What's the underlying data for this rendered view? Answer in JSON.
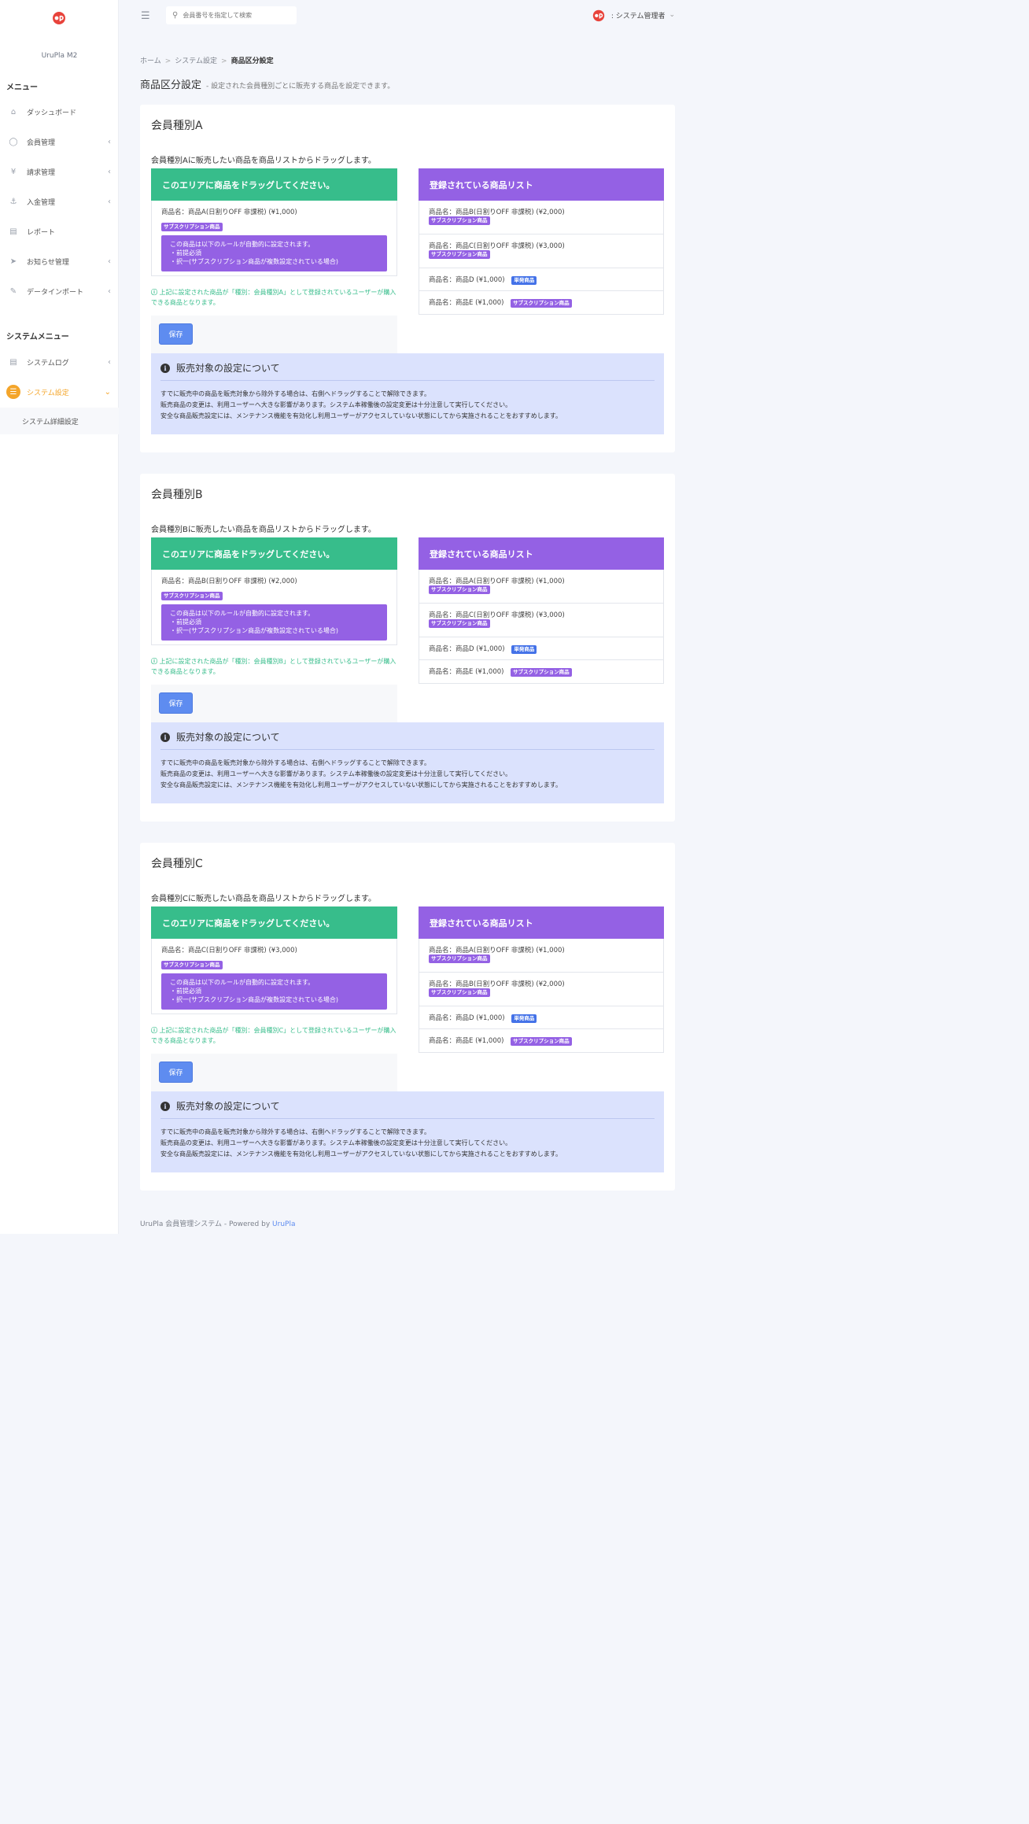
{
  "app": {
    "brand": "UruPla M2"
  },
  "sidebar": {
    "menu_heading": "メニュー",
    "items": [
      {
        "label": "ダッシュボード",
        "icon": "home-icon",
        "has_chevron": false
      },
      {
        "label": "会員管理",
        "icon": "user-icon",
        "has_chevron": true
      },
      {
        "label": "請求管理",
        "icon": "yen-icon",
        "has_chevron": true
      },
      {
        "label": "入金管理",
        "icon": "bank-icon",
        "has_chevron": true
      },
      {
        "label": "レポート",
        "icon": "document-icon",
        "has_chevron": false
      },
      {
        "label": "お知らせ管理",
        "icon": "paper-plane-icon",
        "has_chevron": true
      },
      {
        "label": "データインポート",
        "icon": "edit-icon",
        "has_chevron": true
      }
    ],
    "system_heading": "システムメニュー",
    "system_items": [
      {
        "label": "システムログ",
        "icon": "document-icon",
        "has_chevron": true
      },
      {
        "label": "システム設定",
        "icon": "layers-icon",
        "has_chevron": true,
        "active": true
      }
    ],
    "submenu": "システム詳細設定"
  },
  "topbar": {
    "search_placeholder": "会員番号を指定して検索",
    "user_label": ": システム管理者"
  },
  "breadcrumb": {
    "home": "ホーム",
    "parent": "システム設定",
    "current": "商品区分設定",
    "sep": ">"
  },
  "page": {
    "title": "商品区分設定",
    "subtitle": "- 設定された会員種別ごとに販売する商品を設定できます。"
  },
  "common": {
    "drop_heading": "このエリアに商品をドラッグしてください。",
    "list_heading": "登録されている商品リスト",
    "rule_lines": [
      "この商品は以下のルールが自動的に設定されます。",
      "・前提必須",
      "・択一(サブスクリプション商品が複数設定されている場合)"
    ],
    "save": "保存",
    "info_title": "販売対象の設定について",
    "info_lines": [
      "すでに販売中の商品を販売対象から除外する場合は、右側へドラッグすることで解除できます。",
      "販売商品の変更は、利用ユーザーへ大きな影響があります。システム本稼働後の設定変更は十分注意して実行してください。",
      "安全な商品販売設定には、メンテナンス機能を有効化し利用ユーザーがアクセスしていない状態にしてから実施されることをおすすめします。"
    ]
  },
  "sections": [
    {
      "title": "会員種別A",
      "desc": "会員種別Aに販売したい商品を商品リストからドラッグします。",
      "assigned": {
        "name": "商品名：商品A(日割りOFF 非課税) (¥1,000)",
        "badge": "サブスクリプション商品"
      },
      "note": "上記に設定された商品が「種別：会員種別A」として登録されているユーザーが購入できる商品となります。",
      "list": [
        {
          "name": "商品名：商品B(日割りOFF 非課税) (¥2,000)",
          "badge": "サブスクリプション商品",
          "badge_type": "sub",
          "inline": false
        },
        {
          "name": "商品名：商品C(日割りOFF 非課税) (¥3,000)",
          "badge": "サブスクリプション商品",
          "badge_type": "sub",
          "inline": false
        },
        {
          "name": "商品名：商品D (¥1,000)",
          "badge": "単発商品",
          "badge_type": "single",
          "inline": true
        },
        {
          "name": "商品名：商品E (¥1,000)",
          "badge": "サブスクリプション商品",
          "badge_type": "sub",
          "inline": true
        }
      ]
    },
    {
      "title": "会員種別B",
      "desc": "会員種別Bに販売したい商品を商品リストからドラッグします。",
      "assigned": {
        "name": "商品名：商品B(日割りOFF 非課税) (¥2,000)",
        "badge": "サブスクリプション商品"
      },
      "note": "上記に設定された商品が「種別：会員種別B」として登録されているユーザーが購入できる商品となります。",
      "list": [
        {
          "name": "商品名：商品A(日割りOFF 非課税) (¥1,000)",
          "badge": "サブスクリプション商品",
          "badge_type": "sub",
          "inline": false
        },
        {
          "name": "商品名：商品C(日割りOFF 非課税) (¥3,000)",
          "badge": "サブスクリプション商品",
          "badge_type": "sub",
          "inline": false
        },
        {
          "name": "商品名：商品D (¥1,000)",
          "badge": "単発商品",
          "badge_type": "single",
          "inline": true
        },
        {
          "name": "商品名：商品E (¥1,000)",
          "badge": "サブスクリプション商品",
          "badge_type": "sub",
          "inline": true
        }
      ]
    },
    {
      "title": "会員種別C",
      "desc": "会員種別Cに販売したい商品を商品リストからドラッグします。",
      "assigned": {
        "name": "商品名：商品C(日割りOFF 非課税) (¥3,000)",
        "badge": "サブスクリプション商品"
      },
      "note": "上記に設定された商品が「種別：会員種別C」として登録されているユーザーが購入できる商品となります。",
      "list": [
        {
          "name": "商品名：商品A(日割りOFF 非課税) (¥1,000)",
          "badge": "サブスクリプション商品",
          "badge_type": "sub",
          "inline": false
        },
        {
          "name": "商品名：商品B(日割りOFF 非課税) (¥2,000)",
          "badge": "サブスクリプション商品",
          "badge_type": "sub",
          "inline": false
        },
        {
          "name": "商品名：商品D (¥1,000)",
          "badge": "単発商品",
          "badge_type": "single",
          "inline": true
        },
        {
          "name": "商品名：商品E (¥1,000)",
          "badge": "サブスクリプション商品",
          "badge_type": "sub",
          "inline": true
        }
      ]
    }
  ],
  "footer": {
    "text": "UruPla 会員管理システム - Powered by",
    "link": "UruPla"
  },
  "colors": {
    "green": "#37bd8b",
    "purple": "#9461e4",
    "blue": "#5e8cf0",
    "orange": "#f4a52a",
    "info_bg": "#dbe2fd"
  }
}
